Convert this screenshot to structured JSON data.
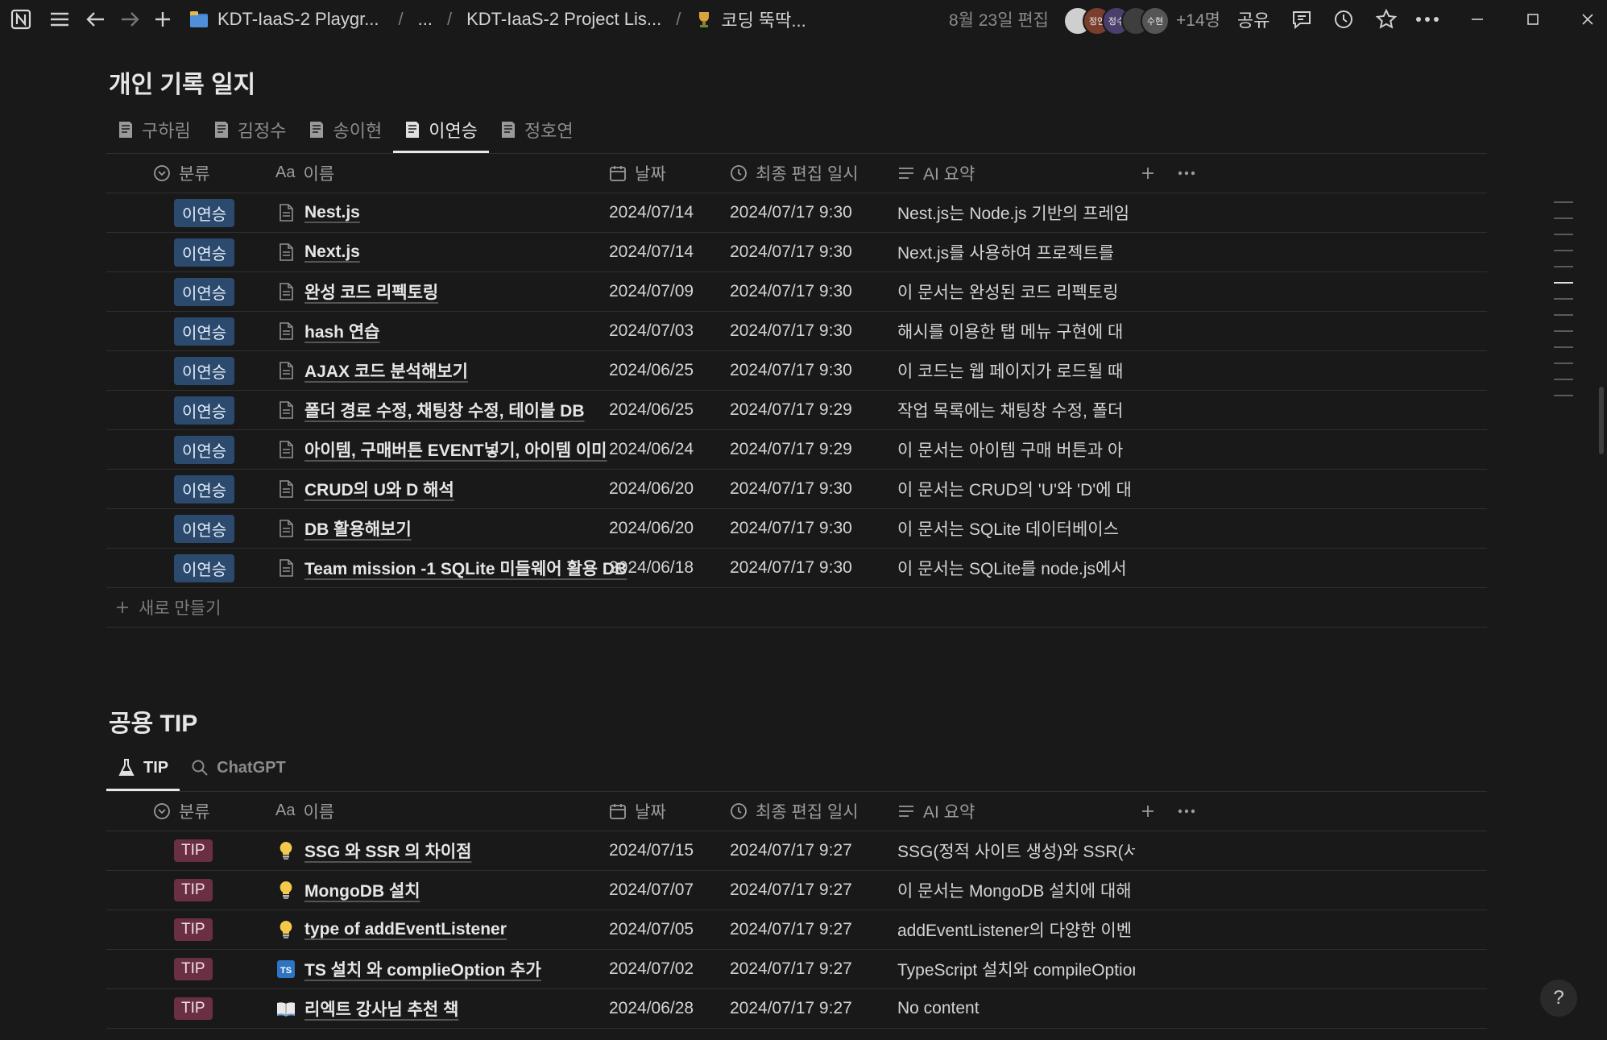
{
  "topbar": {
    "breadcrumbs": [
      "KDT-IaaS-2 Playgr...",
      "...",
      "KDT-IaaS-2 Project Lis...",
      "코딩 뚝딱..."
    ],
    "edited": "8월 23일 편집",
    "avatars": [
      "",
      "정연",
      "정수",
      "",
      "수현"
    ],
    "more_people": "+14명",
    "share": "공유"
  },
  "section1": {
    "title": "개인 기록 일지",
    "tabs": [
      "구하림",
      "김정수",
      "송이현",
      "이연승",
      "정호연"
    ],
    "active_tab": 3,
    "headers": {
      "category": "분류",
      "name": "이름",
      "date": "날짜",
      "edited": "최종 편집 일시",
      "summary": "AI 요약"
    },
    "rows": [
      {
        "category": "이연승",
        "name": "Nest.js",
        "date": "2024/07/14",
        "edited": "2024/07/17 9:30",
        "summary": "Nest.js는 Node.js 기반의 프레임"
      },
      {
        "category": "이연승",
        "name": "Next.js",
        "date": "2024/07/14",
        "edited": "2024/07/17 9:30",
        "summary": "Next.js를 사용하여 프로젝트를"
      },
      {
        "category": "이연승",
        "name": "완성 코드 리펙토링",
        "date": "2024/07/09",
        "edited": "2024/07/17 9:30",
        "summary": "이 문서는 완성된 코드 리펙토링"
      },
      {
        "category": "이연승",
        "name": "hash 연습",
        "date": "2024/07/03",
        "edited": "2024/07/17 9:30",
        "summary": "해시를 이용한 탭 메뉴 구현에 대"
      },
      {
        "category": "이연승",
        "name": "AJAX 코드 분석해보기",
        "date": "2024/06/25",
        "edited": "2024/07/17 9:30",
        "summary": "이 코드는 웹 페이지가 로드될 때"
      },
      {
        "category": "이연승",
        "name": "폴더 경로 수정, 채팅창 수정, 테이블 DB",
        "date": "2024/06/25",
        "edited": "2024/07/17 9:29",
        "summary": "작업 목록에는 채팅창 수정, 폴더"
      },
      {
        "category": "이연승",
        "name": "아이템, 구매버튼 EVENT넣기, 아이템 이미",
        "date": "2024/06/24",
        "edited": "2024/07/17 9:29",
        "summary": "이 문서는 아이템 구매 버튼과 아"
      },
      {
        "category": "이연승",
        "name": "CRUD의 U와 D 해석",
        "date": "2024/06/20",
        "edited": "2024/07/17 9:30",
        "summary": "이 문서는 CRUD의 'U'와 'D'에 대"
      },
      {
        "category": "이연승",
        "name": "DB 활용해보기",
        "date": "2024/06/20",
        "edited": "2024/07/17 9:30",
        "summary": "이 문서는 SQLite 데이터베이스"
      },
      {
        "category": "이연승",
        "name": "Team mission -1 SQLite 미들웨어 활용 DB",
        "date": "2024/06/18",
        "edited": "2024/07/17 9:30",
        "summary": "이 문서는 SQLite를 node.js에서"
      }
    ],
    "new_label": "새로 만들기"
  },
  "section2": {
    "title": "공용 TIP",
    "tabs": [
      "TIP",
      "ChatGPT"
    ],
    "active_tab": 0,
    "headers": {
      "category": "분류",
      "name": "이름",
      "date": "날짜",
      "edited": "최종 편집 일시",
      "summary": "AI 요약"
    },
    "rows": [
      {
        "category": "TIP",
        "icon": "lightbulb-icon",
        "name": "SSG 와 SSR 의 차이점",
        "date": "2024/07/15",
        "edited": "2024/07/17 9:27",
        "summary": "SSG(정적 사이트 생성)와 SSR(서"
      },
      {
        "category": "TIP",
        "icon": "lightbulb-icon",
        "name": "MongoDB 설치",
        "date": "2024/07/07",
        "edited": "2024/07/17 9:27",
        "summary": "이 문서는 MongoDB 설치에 대해"
      },
      {
        "category": "TIP",
        "icon": "lightbulb-icon",
        "name": "type of addEventListener",
        "date": "2024/07/05",
        "edited": "2024/07/17 9:27",
        "summary": "addEventListener의 다양한 이벤"
      },
      {
        "category": "TIP",
        "icon": "typescript-icon",
        "name": "TS 설치 와 complieOption 추가",
        "date": "2024/07/02",
        "edited": "2024/07/17 9:27",
        "summary": "TypeScript 설치와 compileOption"
      },
      {
        "category": "TIP",
        "icon": "open-book-icon",
        "name": "리엑트 강사님 추천 책",
        "date": "2024/06/28",
        "edited": "2024/07/17 9:27",
        "summary": "No content"
      }
    ]
  },
  "help": "?"
}
